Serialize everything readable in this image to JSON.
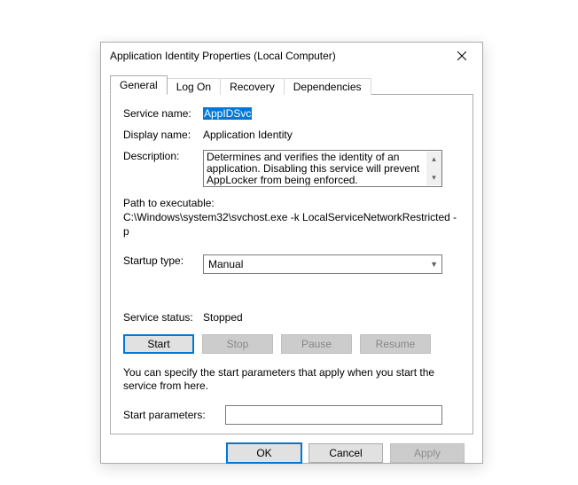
{
  "window": {
    "title": "Application Identity Properties (Local Computer)"
  },
  "tabs": [
    "General",
    "Log On",
    "Recovery",
    "Dependencies"
  ],
  "general": {
    "service_name_label": "Service name:",
    "service_name_value": "AppIDSvc",
    "display_name_label": "Display name:",
    "display_name_value": "Application Identity",
    "description_label": "Description:",
    "description_value": "Determines and verifies the identity of an application. Disabling this service will prevent AppLocker from being enforced.",
    "path_label": "Path to executable:",
    "path_value": "C:\\Windows\\system32\\svchost.exe -k LocalServiceNetworkRestricted -p",
    "startup_label": "Startup type:",
    "startup_value": "Manual",
    "status_label": "Service status:",
    "status_value": "Stopped",
    "buttons": {
      "start": "Start",
      "stop": "Stop",
      "pause": "Pause",
      "resume": "Resume"
    },
    "hint": "You can specify the start parameters that apply when you start the service from here.",
    "start_params_label": "Start parameters:",
    "start_params_value": ""
  },
  "dialog": {
    "ok": "OK",
    "cancel": "Cancel",
    "apply": "Apply"
  }
}
